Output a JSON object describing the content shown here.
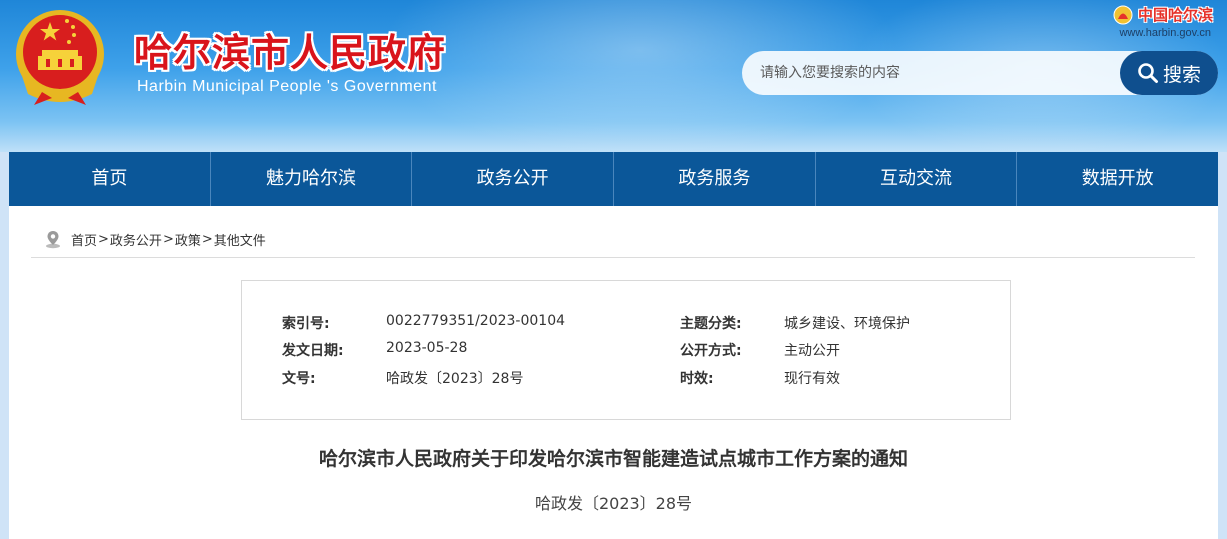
{
  "header": {
    "title": "哈尔滨市人民政府",
    "subtitle": "Harbin Municipal People 's Government",
    "brand_name": "中国哈尔滨",
    "brand_url": "www.harbin.gov.cn"
  },
  "search": {
    "placeholder": "请输入您要搜索的内容",
    "button_label": "搜索"
  },
  "nav": {
    "items": [
      "首页",
      "魅力哈尔滨",
      "政务公开",
      "政务服务",
      "互动交流",
      "数据开放"
    ]
  },
  "breadcrumb": {
    "items": [
      "首页",
      "政务公开",
      "政策",
      "其他文件"
    ],
    "separator": ">"
  },
  "meta": {
    "index_label": "索引号:",
    "index_value": "0022779351/2023-00104",
    "topic_label": "主题分类:",
    "topic_value": "城乡建设、环境保护",
    "date_label": "发文日期:",
    "date_value": "2023-05-28",
    "method_label": "公开方式:",
    "method_value": "主动公开",
    "doc_no_label": "文号:",
    "doc_no_value": "哈政发〔2023〕28号",
    "validity_label": "时效:",
    "validity_value": "现行有效"
  },
  "document": {
    "title": "哈尔滨市人民政府关于印发哈尔滨市智能建造试点城市工作方案的通知",
    "number": "哈政发〔2023〕28号"
  },
  "colors": {
    "nav_bg": "#0b5799",
    "title_red": "#d9141b",
    "search_button": "#0f4f8e"
  }
}
